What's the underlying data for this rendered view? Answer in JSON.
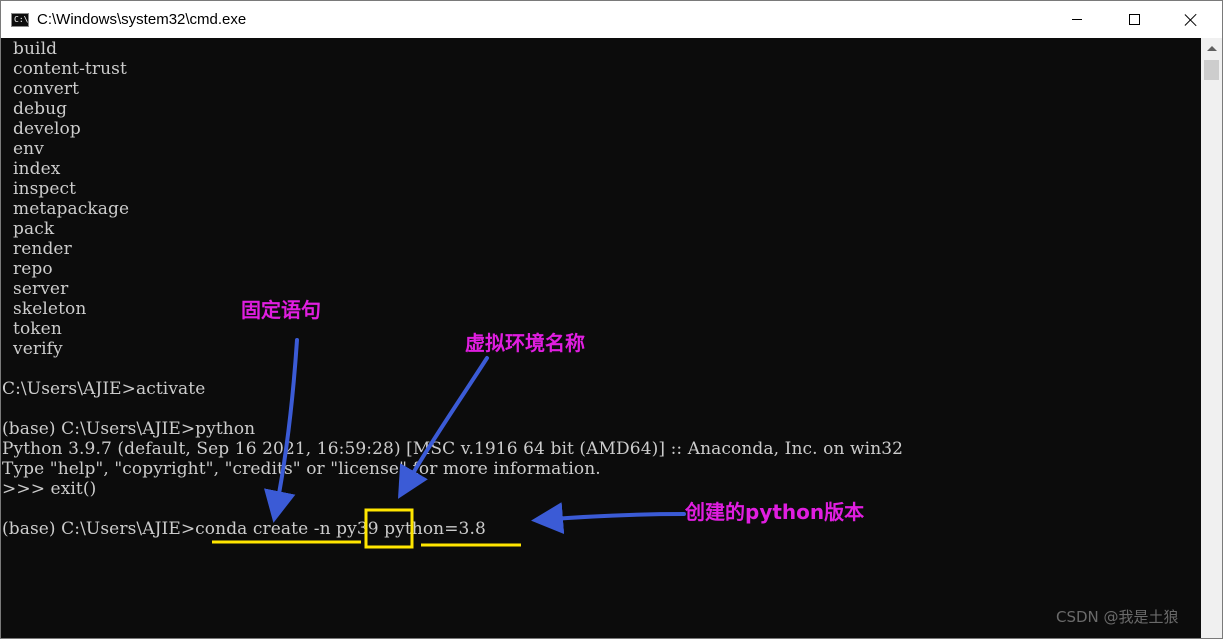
{
  "window": {
    "title": "C:\\Windows\\system32\\cmd.exe",
    "icon": "cmd-icon",
    "icon_text": "C:\\."
  },
  "console": {
    "lines": [
      "  build",
      "  content-trust",
      "  convert",
      "  debug",
      "  develop",
      "  env",
      "  index",
      "  inspect",
      "  metapackage",
      "  pack",
      "  render",
      "  repo",
      "  server",
      "  skeleton",
      "  token",
      "  verify",
      "",
      "C:\\Users\\AJIE>activate",
      "",
      "(base) C:\\Users\\AJIE>python",
      "Python 3.9.7 (default, Sep 16 2021, 16:59:28) [MSC v.1916 64 bit (AMD64)] :: Anaconda, Inc. on win32",
      "Type \"help\", \"copyright\", \"credits\" or \"license\" for more information.",
      ">>> exit()",
      "",
      "(base) C:\\Users\\AJIE>conda create -n py39 python=3.8"
    ],
    "text_color": "#cccccc",
    "background": "#0c0c0c"
  },
  "annotations": {
    "fixed_statement": "固定语句",
    "env_name": "虚拟环境名称",
    "python_version": "创建的python版本",
    "label_color": "#e01ee0",
    "arrow_color": "#3b5bd6",
    "highlight_color": "#ffe600"
  },
  "watermark": "CSDN @我是土狼"
}
